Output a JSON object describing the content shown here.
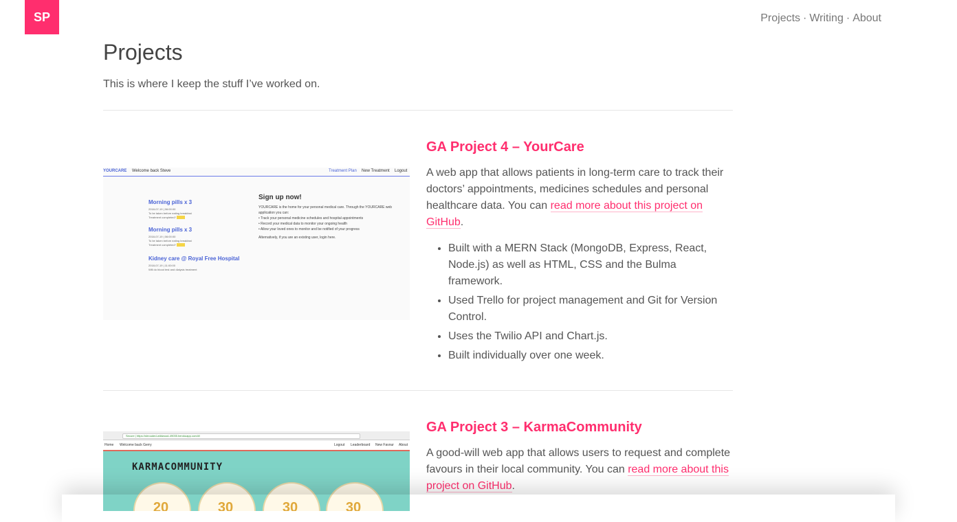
{
  "header": {
    "logo": "SP",
    "nav": [
      "Projects",
      "Writing",
      "About"
    ],
    "sep": "·"
  },
  "page": {
    "title": "Projects",
    "subtitle": "This is where I keep the stuff I’ve worked on."
  },
  "projects": [
    {
      "title": "GA Project 4 – YourCare",
      "desc_text": "A web app that allows patients in long-term care to track their doctors’ appointments, medicines schedules and personal healthcare data. You can ",
      "link": "read more about this project on GitHub",
      "desc_end": ".",
      "bullets": [
        "Built with a MERN Stack (MongoDB, Express, React, Node.js) as well as HTML, CSS and the Bulma framework.",
        "Used Trello for project management and Git for Version Control.",
        "Uses the Twilio API and Chart.js.",
        "Built individually over one week."
      ],
      "thumb": {
        "brand": "YOURCARE",
        "welcome": "Welcome back Steve",
        "nav": [
          "Treatment Plan",
          "New Treatment",
          "Logout"
        ],
        "items": [
          {
            "title": "Morning pills x 3",
            "meta": "2018-07-19 | 06:00:00",
            "note": "To be taken before eating breakfast",
            "q": "Treatment completed?"
          },
          {
            "title": "Morning pills x 3",
            "meta": "2018-07-19 | 06:00:00",
            "note": "To be taken before eating breakfast",
            "q": "Treatment completed?"
          },
          {
            "title": "Kidney care @ Royal Free Hospital",
            "meta": "2018-07-19 | 11:00:00",
            "note": "Will do blood test and dialysis treatment",
            "q": ""
          }
        ],
        "signup": "Sign up now!",
        "signup_text": "YOURCARE is the home for your personal medical care. Through the YOURCARE web application you can:",
        "signup_points": [
          "Track your personal medicine schedules and hospital appointments",
          "Record your medical data to monitor your ongoing health",
          "Allow your loved ones to monitor and be notified of your progress"
        ],
        "signup_foot": "Alternatively, if you are an existing user, login here."
      }
    },
    {
      "title": "GA Project 3 – KarmaCommunity",
      "desc_text": "A good-will web app that allows users to request and complete favours in their local community. You can ",
      "link": "read more about this project on GitHub",
      "desc_end": ".",
      "thumb": {
        "url": "Secure | https://shrouded-wildwood-49035.herokuapp.com/#/",
        "menu_left": [
          "Home",
          "Welcome back Gerry"
        ],
        "menu_right": [
          "Logout",
          "Leaderboard",
          "New Favour",
          "About"
        ],
        "title": "KARMACOMMUNITY",
        "numbers": [
          "20",
          "30",
          "30",
          "30"
        ]
      }
    }
  ]
}
